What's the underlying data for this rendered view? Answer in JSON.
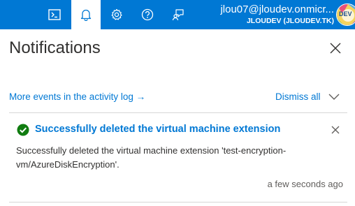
{
  "topbar": {
    "buttons": [
      {
        "icon": "cloud-shell-icon"
      },
      {
        "icon": "bell-icon",
        "active": true
      },
      {
        "icon": "gear-icon"
      },
      {
        "icon": "help-icon"
      },
      {
        "icon": "feedback-icon"
      }
    ],
    "account": {
      "email": "jlou07@jloudev.onmicr...",
      "directory": "JLOUDEV (JLOUDEV.TK)",
      "avatar_text": "DEV"
    }
  },
  "panel": {
    "title": "Notifications",
    "activity_link": "More events in the activity log →",
    "dismiss_all": "Dismiss all"
  },
  "notifications": [
    {
      "status": "success",
      "title": "Successfully deleted the virtual machine extension",
      "body": "Successfully deleted the virtual machine extension 'test-encryption-vm/AzureDiskEncryption'.",
      "time": "a few seconds ago"
    }
  ],
  "colors": {
    "brand": "#0078d4",
    "success": "#107c10",
    "text": "#323130",
    "muted": "#605e5c"
  }
}
